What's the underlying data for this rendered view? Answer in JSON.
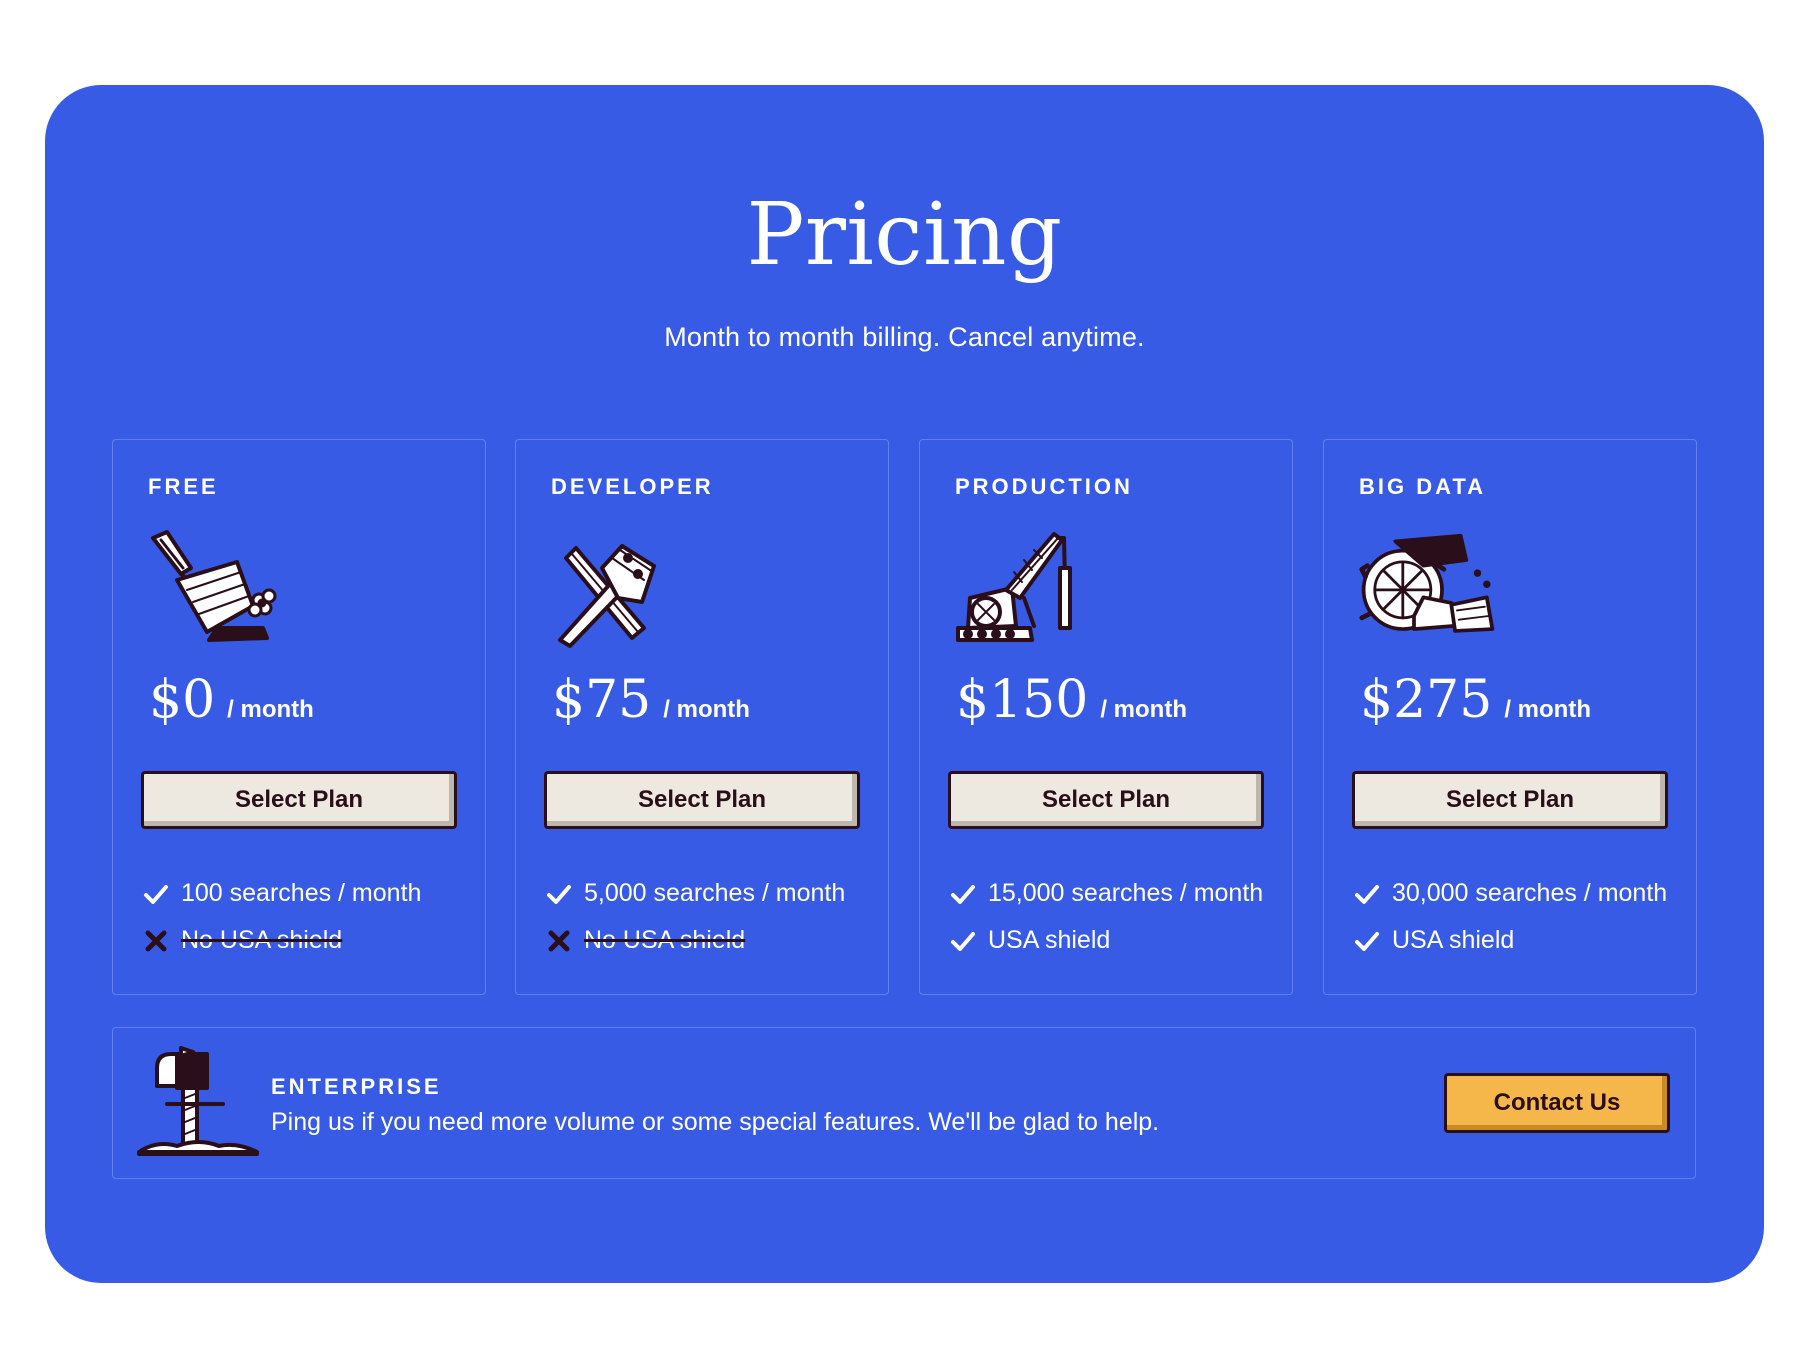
{
  "header": {
    "title": "Pricing",
    "subtitle": "Month to month billing. Cancel anytime."
  },
  "colors": {
    "panel": "#385be6",
    "button_plan": "#eee9e0",
    "button_contact": "#f6b74a",
    "ink": "#2a0f1a",
    "text": "#ffffff"
  },
  "plans": [
    {
      "name": "FREE",
      "price": "$0",
      "per": "/ month",
      "button": "Select Plan",
      "illustration": "trowel-icon",
      "features": [
        {
          "text": "100 searches / month",
          "included": true
        },
        {
          "text": "No USA shield",
          "included": false
        }
      ]
    },
    {
      "name": "DEVELOPER",
      "price": "$75",
      "per": "/ month",
      "button": "Select Plan",
      "illustration": "hammer-icon",
      "features": [
        {
          "text": "5,000 searches / month",
          "included": true
        },
        {
          "text": "No USA shield",
          "included": false
        }
      ]
    },
    {
      "name": "PRODUCTION",
      "price": "$150",
      "per": "/ month",
      "button": "Select Plan",
      "illustration": "crane-icon",
      "features": [
        {
          "text": "15,000 searches / month",
          "included": true
        },
        {
          "text": "USA shield",
          "included": true
        }
      ]
    },
    {
      "name": "BIG DATA",
      "price": "$275",
      "per": "/ month",
      "button": "Select Plan",
      "illustration": "bucket-wheel-excavator-icon",
      "features": [
        {
          "text": "30,000 searches / month",
          "included": true
        },
        {
          "text": "USA shield",
          "included": true
        }
      ]
    }
  ],
  "enterprise": {
    "name": "ENTERPRISE",
    "description": "Ping us if you need more volume or some special features. We'll be glad to help.",
    "button": "Contact Us",
    "illustration": "mailbox-icon"
  }
}
